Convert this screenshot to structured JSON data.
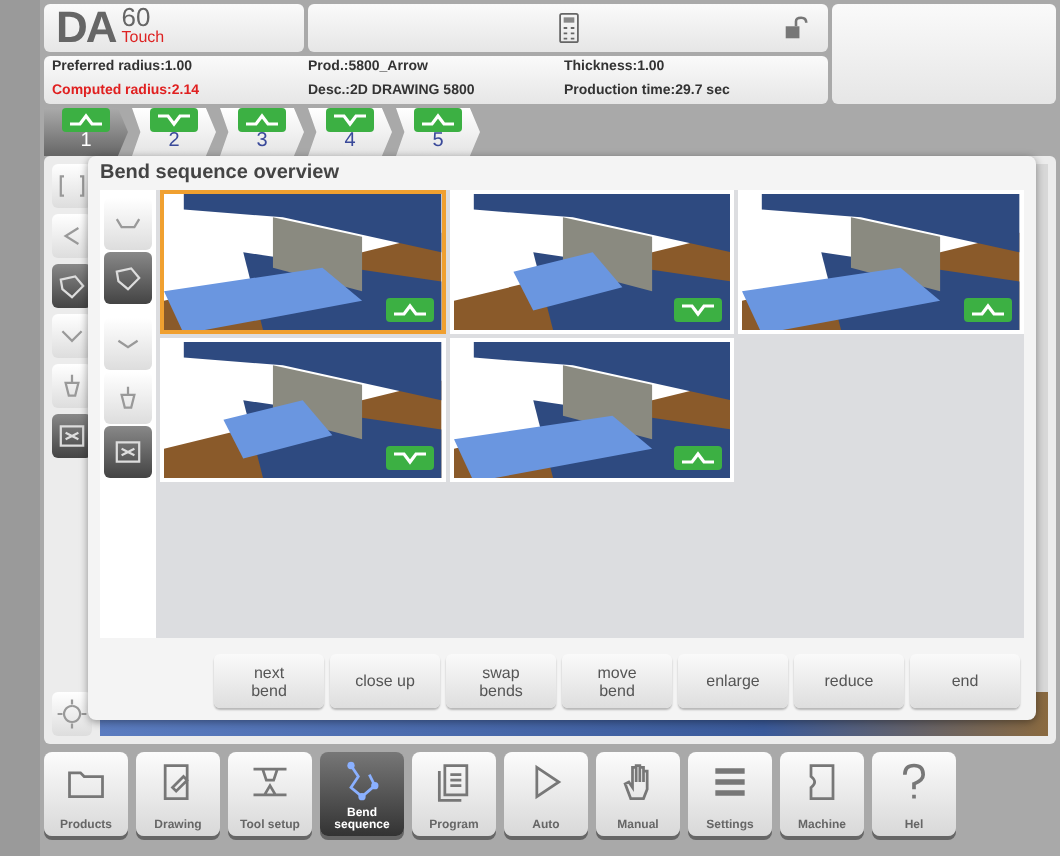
{
  "header": {
    "brand": "DA",
    "model": "60",
    "edition": "Touch",
    "info": [
      {
        "text": "Preferred radius:1.00",
        "warning": false
      },
      {
        "text": "Prod.:5800_Arrow",
        "warning": false
      },
      {
        "text": "Thickness:1.00",
        "warning": false
      },
      {
        "text": "Computed radius:2.14",
        "warning": true
      },
      {
        "text": "Desc.:2D DRAWING 5800",
        "warning": false
      },
      {
        "text": "Production time:29.7 sec",
        "warning": false
      }
    ]
  },
  "bend_tabs": [
    {
      "label": "1",
      "selected": true
    },
    {
      "label": "2",
      "selected": false
    },
    {
      "label": "3",
      "selected": false
    },
    {
      "label": "4",
      "selected": false
    },
    {
      "label": "5",
      "selected": false
    }
  ],
  "dialog": {
    "title": "Bend sequence overview",
    "previews": [
      {
        "selected": true
      },
      {
        "selected": false
      },
      {
        "selected": false
      },
      {
        "selected": false
      },
      {
        "selected": false
      }
    ],
    "buttons": [
      {
        "lines": [
          "next",
          "bend"
        ]
      },
      {
        "lines": [
          "close up"
        ]
      },
      {
        "lines": [
          "swap",
          "bends"
        ]
      },
      {
        "lines": [
          "move",
          "bend"
        ]
      },
      {
        "lines": [
          "enlarge"
        ]
      },
      {
        "lines": [
          "reduce"
        ]
      },
      {
        "lines": [
          "end"
        ]
      }
    ]
  },
  "nav": [
    {
      "label": "Products",
      "selected": false
    },
    {
      "label": "Drawing",
      "selected": false
    },
    {
      "label": "Tool setup",
      "selected": false
    },
    {
      "label": "Bend sequence",
      "selected": true
    },
    {
      "label": "Program",
      "selected": false
    },
    {
      "label": "Auto",
      "selected": false
    },
    {
      "label": "Manual",
      "selected": false
    },
    {
      "label": "Settings",
      "selected": false
    },
    {
      "label": "Machine",
      "selected": false
    },
    {
      "label": "Hel",
      "selected": false
    }
  ]
}
